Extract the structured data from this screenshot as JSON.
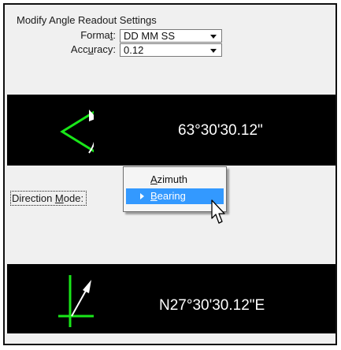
{
  "dialog": {
    "title": "Modify Angle Readout Settings"
  },
  "format": {
    "label_pre": "Forma",
    "label_mnemonic": "t",
    "label_post": ":",
    "value": "DD MM SS"
  },
  "accuracy": {
    "label_pre": "Acc",
    "label_mnemonic": "u",
    "label_post": "racy:",
    "value": "0.12"
  },
  "readout_top": {
    "value": "63°30'30.12\""
  },
  "direction_mode": {
    "label_pre": "Direction ",
    "label_mnemonic": "M",
    "label_post": "ode:",
    "menu": [
      {
        "mnemonic": "A",
        "rest": "zimuth",
        "selected": false
      },
      {
        "mnemonic": "B",
        "rest": "earing",
        "selected": true
      }
    ]
  },
  "readout_bottom": {
    "value": "N27°30'30.12\"E"
  },
  "colors": {
    "angle_green": "#19e619",
    "readout_bg": "#000000",
    "highlight": "#3399ff"
  }
}
